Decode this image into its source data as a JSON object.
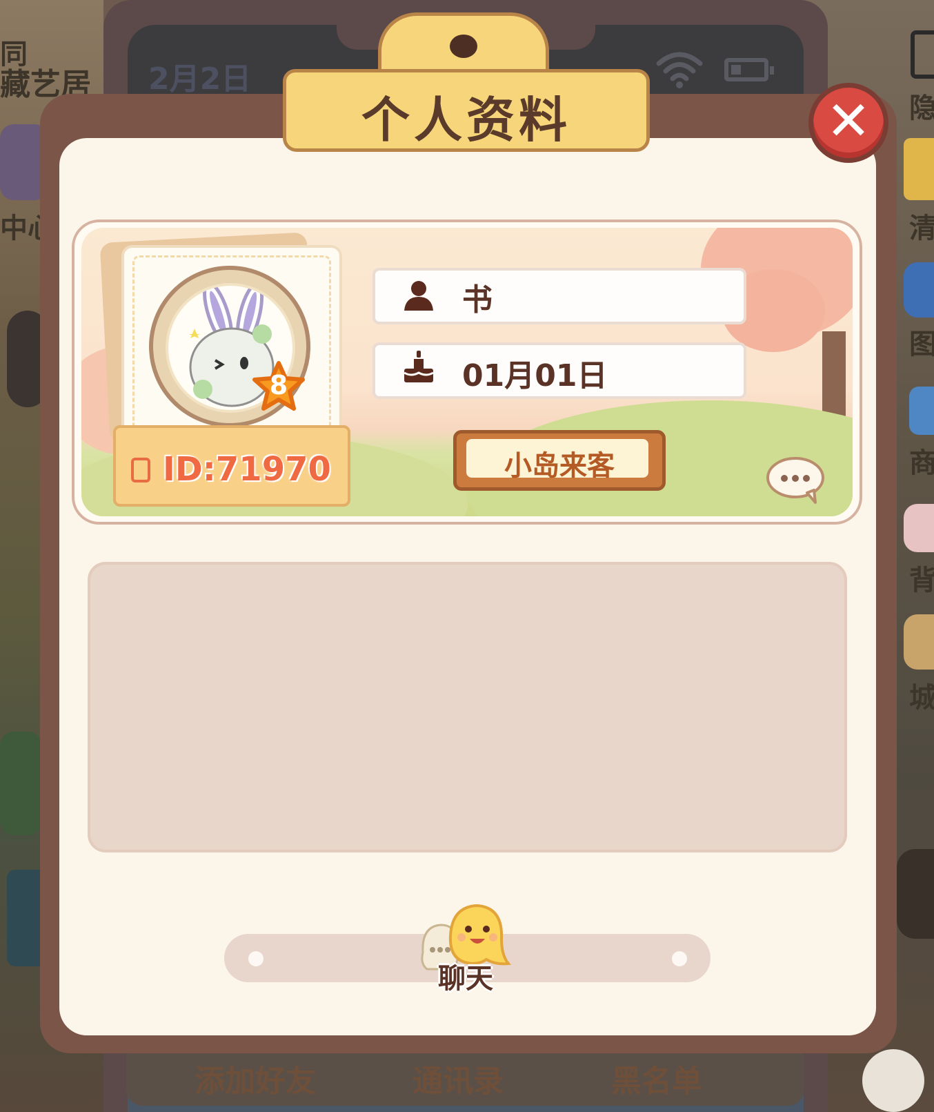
{
  "background": {
    "status_date": "2月2日",
    "left_labels": [
      "同",
      "藏艺居",
      "中心"
    ],
    "right_labels": [
      "隐",
      "清",
      "图",
      "商",
      "背",
      "城"
    ],
    "bottom_tabs": [
      "添加好友",
      "通讯录",
      "黑名单"
    ]
  },
  "modal": {
    "title": "个人资料",
    "close_symbol": "✕"
  },
  "profile": {
    "id_label": "ID:71970",
    "level": "8",
    "name": "书",
    "birthday": "01月01日",
    "visitor_button": "小岛来客",
    "name_icon": "person-icon",
    "birthday_icon": "cake-icon"
  },
  "bio": {
    "text": ""
  },
  "actions": {
    "chat_label": "聊天"
  },
  "colors": {
    "frame": "#7b5548",
    "panel": "#fcf6ea",
    "title_board": "#f7d57a",
    "close_red": "#d94a43",
    "id_orange": "#ef6a43",
    "visitor_button": "#cc7b3e"
  }
}
